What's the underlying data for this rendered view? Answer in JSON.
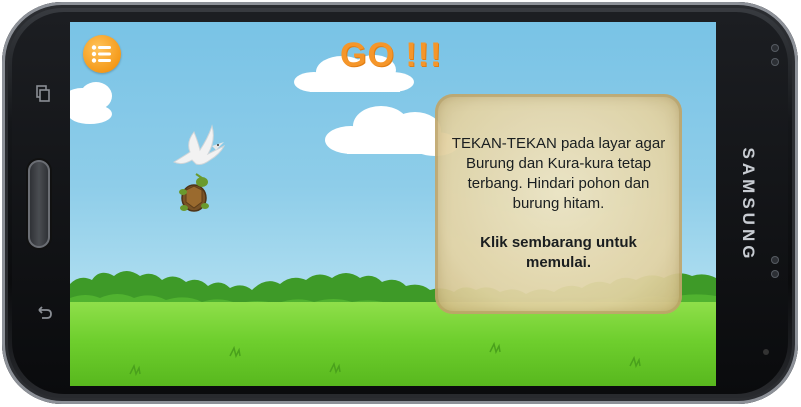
{
  "device": {
    "brand": "SAMSUNG"
  },
  "game": {
    "title": "GO !!!",
    "instructions": "TEKAN-TEKAN pada layar agar Burung dan Kura-kura tetap terbang. Hindari pohon dan burung hitam.",
    "start_hint": "Klik sembarang untuk memulai."
  },
  "icons": {
    "menu": "list-menu-icon",
    "bird": "white-bird",
    "turtle": "turtle",
    "recent_apps": "recent-apps-icon",
    "back": "back-icon"
  },
  "colors": {
    "sky": "#8ecde9",
    "title": "#f5962a",
    "menu_button": "#f59a1a",
    "grass": "#6fcf2e",
    "bushes": "#3e9a28",
    "panel": "#e4d3a3"
  }
}
